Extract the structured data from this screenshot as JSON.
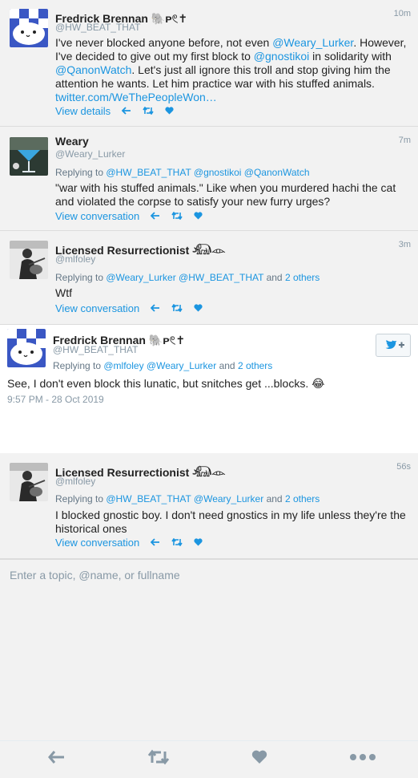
{
  "tweets": [
    {
      "name": "Fredrick Brennan 🐘ᴘ𓏲✝",
      "handle": "@HW_BEAT_THAT",
      "time": "10m",
      "text_a": "I've never blocked anyone before, not even ",
      "mention_1": "@Weary_Lurker",
      "text_b": ". However, I've decided to give out my first block to ",
      "mention_2": "@gnostikoi",
      "text_c": " in solidarity with ",
      "mention_3": "@QanonWatch",
      "text_d": ". Let's just all ignore this troll and stop giving him the attention he wants. Let him practice war with his stuffed animals.",
      "url": "twitter.com/WeThePeopleWon…",
      "action_label": "View details"
    },
    {
      "name": "Weary",
      "handle": "@Weary_Lurker",
      "time": "7m",
      "reply_prefix": "Replying to ",
      "reply_to": "@HW_BEAT_THAT @gnostikoi @QanonWatch",
      "text": "\"war with his stuffed animals.\" Like when you murdered hachi the cat and violated the corpse to satisfy your new furry urges?",
      "action_label": "View conversation"
    },
    {
      "name": "Licensed Resurrectionist 𓃰𓁹",
      "handle": "@mlfoley",
      "time": "3m",
      "reply_prefix": "Replying to ",
      "reply_to": "@Weary_Lurker @HW_BEAT_THAT",
      "reply_and": " and ",
      "reply_others": "2 others",
      "text": "Wtf",
      "action_label": "View conversation"
    },
    {
      "name": "Fredrick Brennan 🐘ᴘ𓏲✝",
      "handle": "@HW_BEAT_THAT",
      "reply_prefix": "Replying to ",
      "reply_to": "@mlfoley @Weary_Lurker",
      "reply_and": " and ",
      "reply_others": "2 others",
      "text": "See, I don't even block this lunatic, but snitches get ...blocks. 😂",
      "timestamp": "9:57 PM - 28 Oct 2019",
      "follow_icon": "twitter-bird-plus-icon"
    },
    {
      "name": "Licensed Resurrectionist 𓃰𓁹",
      "handle": "@mlfoley",
      "time": "56s",
      "reply_prefix": "Replying to ",
      "reply_to": "@HW_BEAT_THAT @Weary_Lurker",
      "reply_and": " and ",
      "reply_others": "2 others",
      "text": "I blocked gnostic boy. I don't need gnostics in my life unless they're the historical ones",
      "action_label": "View conversation"
    }
  ],
  "composer": {
    "placeholder": "Enter a topic, @name, or fullname"
  },
  "icons": {
    "reply": "reply-icon",
    "retweet": "retweet-icon",
    "like": "heart-icon",
    "more": "more-icon"
  },
  "colors": {
    "link": "#1b95e0",
    "muted": "#8899a6",
    "background": "#f2f2f2"
  }
}
